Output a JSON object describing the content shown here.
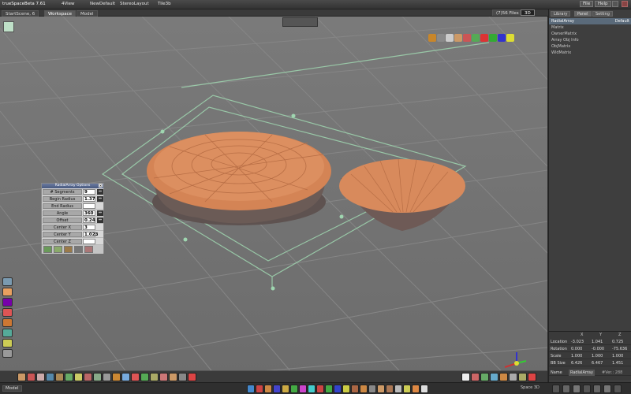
{
  "app": {
    "title": "trueSpaceBeta 7.61",
    "menu": [
      "4View",
      "NewDefault",
      "StereoLayout",
      "Tile3b"
    ],
    "file_label": "File",
    "help_label": "Help",
    "files_label": "(7)56 Files",
    "mode_label": "3D"
  },
  "tabs": [
    {
      "label": "StartScene, 6"
    },
    {
      "label": "Workspace"
    },
    {
      "label": "Model"
    }
  ],
  "right_panel": {
    "tabs": [
      "Library",
      "Panel",
      "Setting"
    ],
    "header": "RadialArray",
    "header_right": "Default",
    "tree": [
      "Matrix",
      "OwnerMatrix",
      "Array Obj Info",
      "ObjMatrix",
      "WldMatrix"
    ]
  },
  "transform": {
    "headers": [
      "X",
      "Y",
      "Z"
    ],
    "rows": [
      {
        "label": "Location",
        "x": "-3.023",
        "y": "1.041",
        "z": "0.725"
      },
      {
        "label": "Rotation",
        "x": "0.000",
        "y": "-0.000",
        "z": "-75.636"
      },
      {
        "label": "Scale",
        "x": "1.000",
        "y": "1.000",
        "z": "1.000"
      },
      {
        "label": "BB Size",
        "x": "6.426",
        "y": "6.467",
        "z": "1.451"
      }
    ],
    "name_label": "Name",
    "name_value": "RadialArray",
    "ver_label": "#Ver.: 288"
  },
  "options_panel": {
    "title": "RadialArray Options",
    "rows": [
      {
        "label": "# Segments",
        "value": "9",
        "arrow": true
      },
      {
        "label": "Begin Radius",
        "value": "1.37",
        "arrow": true
      },
      {
        "label": "End Radius",
        "value": "",
        "arrow": false
      },
      {
        "label": "Angle",
        "value": "360",
        "arrow": true
      },
      {
        "label": "Offset",
        "value": "0.24",
        "arrow": true
      },
      {
        "label": "Center X",
        "value": "3",
        "arrow": false
      },
      {
        "label": "Center Y",
        "value": "1.023",
        "arrow": false
      },
      {
        "label": "Center Z",
        "value": "",
        "arrow": false
      }
    ]
  },
  "status": {
    "left_label": "Model",
    "right_label": "Space 3D"
  },
  "colors": {
    "viewport_bg": "#747474",
    "grid_line": "#858585",
    "object_orange": "#d98a5a",
    "object_shadow": "#6a5a55",
    "selection_green": "#9fd6b0"
  }
}
